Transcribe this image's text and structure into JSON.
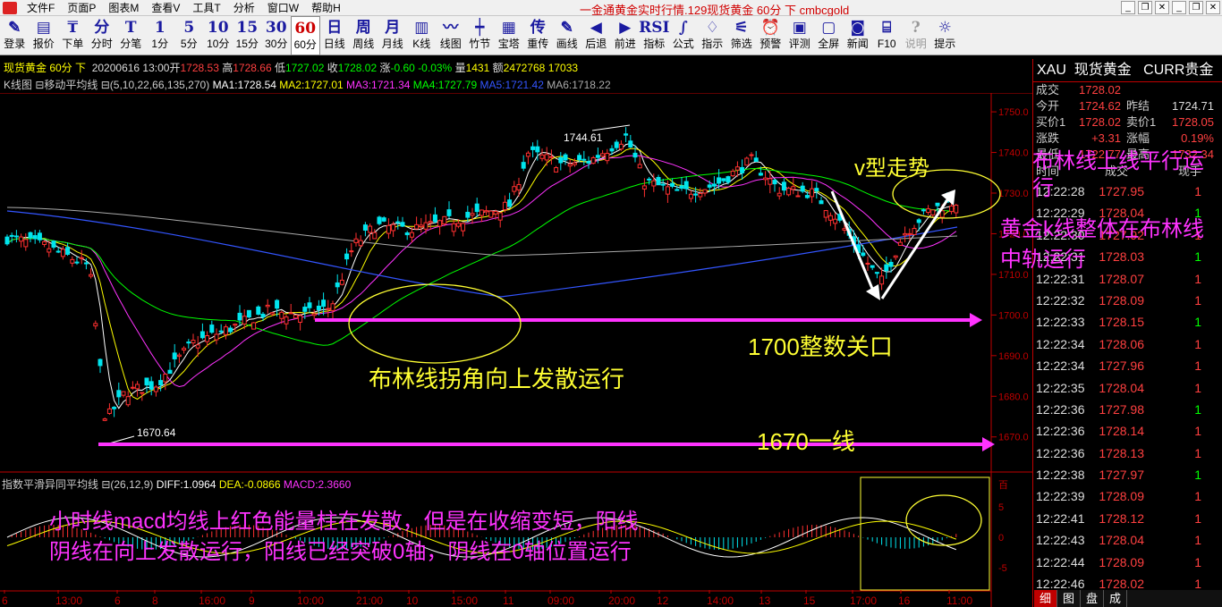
{
  "menu": {
    "items": [
      "文件F",
      "页面P",
      "图表M",
      "查看V",
      "工具T",
      "分析",
      "窗口W",
      "帮助H"
    ],
    "title": "一金通黄金实时行情.129现货黄金 60分 下 cmbcgold"
  },
  "toolbar": [
    {
      "icon": "✎",
      "label": "登录"
    },
    {
      "icon": "▤",
      "label": "报价"
    },
    {
      "icon": "₸",
      "label": "下单"
    },
    {
      "icon": "分",
      "label": "分时"
    },
    {
      "icon": "T",
      "label": "分笔"
    },
    {
      "icon": "1",
      "label": "1分"
    },
    {
      "icon": "5",
      "label": "5分"
    },
    {
      "icon": "10",
      "label": "10分"
    },
    {
      "icon": "15",
      "label": "15分"
    },
    {
      "icon": "30",
      "label": "30分"
    },
    {
      "icon": "60",
      "label": "60分"
    },
    {
      "icon": "日",
      "label": "日线"
    },
    {
      "icon": "周",
      "label": "周线"
    },
    {
      "icon": "月",
      "label": "月线"
    },
    {
      "icon": "▥",
      "label": "K线"
    },
    {
      "icon": "〰",
      "label": "线图"
    },
    {
      "icon": "┿",
      "label": "竹节"
    },
    {
      "icon": "▦",
      "label": "宝塔"
    },
    {
      "icon": "传",
      "label": "重传"
    },
    {
      "icon": "✎",
      "label": "画线"
    },
    {
      "icon": "◀",
      "label": "后退"
    },
    {
      "icon": "▶",
      "label": "前进"
    },
    {
      "icon": "RSI",
      "label": "指标"
    },
    {
      "icon": "∫",
      "label": "公式"
    },
    {
      "icon": "♢",
      "label": "指示"
    },
    {
      "icon": "⚟",
      "label": "筛选"
    },
    {
      "icon": "⏰",
      "label": "预警"
    },
    {
      "icon": "▣",
      "label": "评测"
    },
    {
      "icon": "▢",
      "label": "全屏"
    },
    {
      "icon": "◙",
      "label": "新闻"
    },
    {
      "icon": "⌸",
      "label": "F10"
    },
    {
      "icon": "?",
      "label": "说明"
    },
    {
      "icon": "☼",
      "label": "提示"
    }
  ],
  "info": {
    "name": "现货黄金 60分 下",
    "date": "20200616 13:00",
    "open_l": "开",
    "open": "1728.53",
    "high_l": "高",
    "high": "1728.66",
    "low_l": "低",
    "low": "1727.02",
    "close_l": "收",
    "close": "1728.02",
    "chg_l": "涨",
    "chg": "-0.60",
    "pct": "-0.03%",
    "vol_l": "量",
    "vol": "1431",
    "amt_l": "额",
    "amt": "2472768",
    "extra": "17033"
  },
  "ma": {
    "title": "K线图 ⊟移动平均线 ⊟(5,10,22,66,135,270)",
    "ma1": "MA1:1728.54",
    "ma2": "MA2:1727.01",
    "ma3": "MA3:1721.34",
    "ma4": "MA4:1727.79",
    "ma5": "MA5:1721.42",
    "ma6": "MA6:1718.22"
  },
  "macd": {
    "title": "指数平滑异同平均线 ⊟(26,12,9)",
    "diff": "DIFF:1.0964",
    "dea": "DEA:-0.0866",
    "macd": "MACD:2.3660",
    "axis": [
      "百",
      "5",
      "0",
      "-5"
    ]
  },
  "price_axis": [
    "1750.0",
    "1740.0",
    "1730.0",
    "1720.0",
    "1710.0",
    "1700.0",
    "1690.0",
    "1680.0",
    "1670.0"
  ],
  "time_axis": [
    "6",
    "13:00",
    "6",
    "8",
    "16:00",
    "9",
    "10:00",
    "21:00",
    "10",
    "15:00",
    "11",
    "09:00",
    "20:00",
    "12",
    "14:00",
    "13",
    "15",
    "17:00",
    "16",
    "11:00"
  ],
  "marks": {
    "high": "1744.61",
    "low": "1670.64"
  },
  "annotations": {
    "v_trend": "v型走势",
    "boll_flat": "布林线上线平行运行",
    "gold_mid": "黄金k线整体在布林线中轨运行",
    "boll_up": "布林线拐角向上发散运行",
    "l1700": "1700整数关口",
    "l1670": "1670一线",
    "macd_note1": "小时线macd均线上红色能量柱在发散，但是在收缩变短，阳线",
    "macd_note2": "阴线在向上发散运行，阳线已经突破0轴，阴线在0轴位置运行"
  },
  "colors": {
    "pink": "#ff33ff",
    "yellow": "#ffff33",
    "white": "#ffffff",
    "ma1": "#ffffff",
    "ma2": "#ffff00",
    "ma3": "#ff00ff",
    "ma4": "#00ff00",
    "ma5": "#3355ff",
    "ma6": "#aaaaaa"
  },
  "quote": {
    "header": {
      "code": "XAU",
      "name": "现货黄金",
      "curr": "CURR贵金"
    },
    "rows": [
      {
        "l1": "成交",
        "v1": "1728.02",
        "l2": "",
        "v2": ""
      },
      {
        "l1": "今开",
        "v1": "1724.62",
        "l2": "昨结",
        "v2": "1724.71"
      },
      {
        "l1": "买价1",
        "v1": "1728.02",
        "l2": "卖价1",
        "v2": "1728.05"
      },
      {
        "l1": "涨跌",
        "v1": "+3.31",
        "l2": "涨幅",
        "v2": "0.19%"
      },
      {
        "l1": "最低",
        "v1": "1722.77",
        "l2": "最高",
        "v2": "1732.34"
      }
    ],
    "tick_header": [
      "时间",
      "成交",
      "现手"
    ],
    "ticks": [
      {
        "t": "12:22:28",
        "p": "1727.95",
        "v": "1"
      },
      {
        "t": "12:22:29",
        "p": "1728.04",
        "v": "1"
      },
      {
        "t": "12:22:30",
        "p": "1727.92",
        "v": "1"
      },
      {
        "t": "12:22:31",
        "p": "1728.03",
        "v": "1"
      },
      {
        "t": "12:22:31",
        "p": "1728.07",
        "v": "1"
      },
      {
        "t": "12:22:32",
        "p": "1728.09",
        "v": "1"
      },
      {
        "t": "12:22:33",
        "p": "1728.15",
        "v": "1"
      },
      {
        "t": "12:22:34",
        "p": "1728.06",
        "v": "1"
      },
      {
        "t": "12:22:34",
        "p": "1727.96",
        "v": "1"
      },
      {
        "t": "12:22:35",
        "p": "1728.04",
        "v": "1"
      },
      {
        "t": "12:22:36",
        "p": "1727.98",
        "v": "1"
      },
      {
        "t": "12:22:36",
        "p": "1728.14",
        "v": "1"
      },
      {
        "t": "12:22:36",
        "p": "1728.13",
        "v": "1"
      },
      {
        "t": "12:22:38",
        "p": "1727.97",
        "v": "1"
      },
      {
        "t": "12:22:39",
        "p": "1728.09",
        "v": "1"
      },
      {
        "t": "12:22:41",
        "p": "1728.12",
        "v": "1"
      },
      {
        "t": "12:22:43",
        "p": "1728.04",
        "v": "1"
      },
      {
        "t": "12:22:44",
        "p": "1728.09",
        "v": "1"
      },
      {
        "t": "12:22:46",
        "p": "1728.02",
        "v": "1"
      }
    ],
    "tabs": [
      "细",
      "图",
      "盘",
      "成"
    ]
  }
}
